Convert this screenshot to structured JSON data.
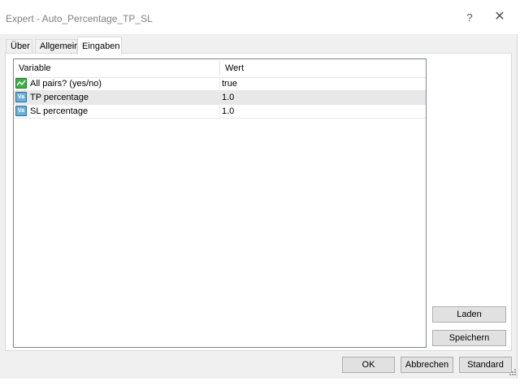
{
  "window": {
    "title": "Expert - Auto_Percentage_TP_SL",
    "help_glyph": "?",
    "close_glyph": "✕"
  },
  "tabs": [
    {
      "label": "Über"
    },
    {
      "label": "Allgemein"
    },
    {
      "label": "Eingaben"
    }
  ],
  "active_tab": "Eingaben",
  "table": {
    "columns": [
      "Variable",
      "Wert"
    ],
    "rows": [
      {
        "variable": "All pairs? (yes/no)",
        "value": "true",
        "icon": "bool-icon"
      },
      {
        "variable": "TP percentage",
        "value": "1.0",
        "icon": "value-icon"
      },
      {
        "variable": "SL percentage",
        "value": "1.0",
        "icon": "value-icon"
      }
    ],
    "value_icon_text": "Va"
  },
  "side_buttons": {
    "load": "Laden",
    "save": "Speichern"
  },
  "dialog_buttons": {
    "ok": "OK",
    "cancel": "Abbrechen",
    "default": "Standard"
  },
  "colors": {
    "client_bg": "#f0f0f0",
    "selected_row": "#e8e8e8",
    "bool_icon": "#3cb043",
    "value_icon": "#6ab0d8"
  }
}
